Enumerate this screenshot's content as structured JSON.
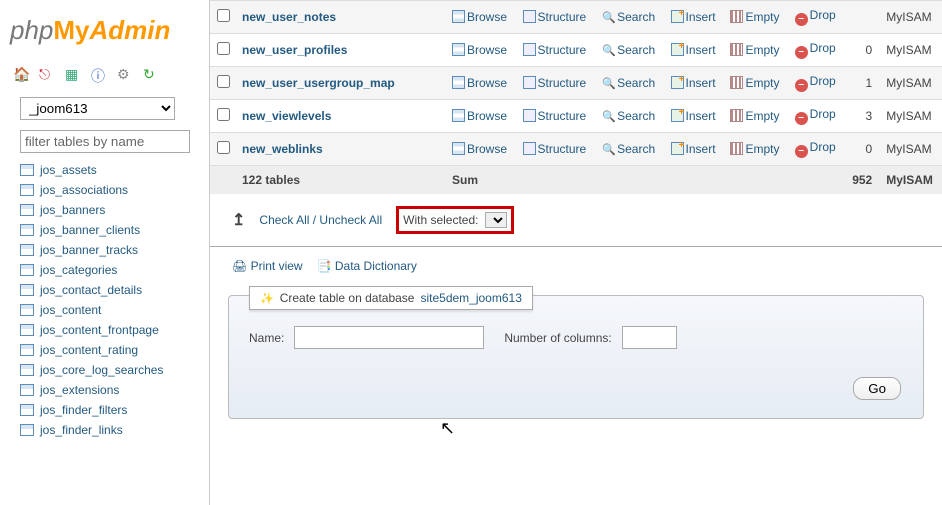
{
  "logo": {
    "php": "php",
    "my": "My",
    "admin": "Admin"
  },
  "db_selected": "_joom613",
  "filter_placeholder": "filter tables by name",
  "sidebar_tables": [
    "jos_assets",
    "jos_associations",
    "jos_banners",
    "jos_banner_clients",
    "jos_banner_tracks",
    "jos_categories",
    "jos_contact_details",
    "jos_content",
    "jos_content_frontpage",
    "jos_content_rating",
    "jos_core_log_searches",
    "jos_extensions",
    "jos_finder_filters",
    "jos_finder_links"
  ],
  "actions": {
    "browse": "Browse",
    "structure": "Structure",
    "search": "Search",
    "insert": "Insert",
    "empty": "Empty",
    "drop": "Drop"
  },
  "tables": [
    {
      "name": "new_user_notes",
      "rows": "",
      "odd": true,
      "cut": true
    },
    {
      "name": "new_user_profiles",
      "rows": "0",
      "odd": false
    },
    {
      "name": "new_user_usergroup_map",
      "rows": "1",
      "odd": true
    },
    {
      "name": "new_viewlevels",
      "rows": "3",
      "odd": false
    },
    {
      "name": "new_weblinks",
      "rows": "0",
      "odd": true
    }
  ],
  "engine": "MyISAM",
  "sum": {
    "count": "122 tables",
    "label": "Sum",
    "rows": "952",
    "engine": "MyISAM"
  },
  "check": {
    "arrow": "↥",
    "label": "Check All / Uncheck All",
    "with_selected": "With selected:"
  },
  "links": {
    "print": "Print view",
    "dict": "Data Dictionary"
  },
  "create": {
    "legend": "Create table on database",
    "dbname": "site5dem_joom613",
    "name_lbl": "Name:",
    "cols_lbl": "Number of columns:",
    "go": "Go"
  }
}
